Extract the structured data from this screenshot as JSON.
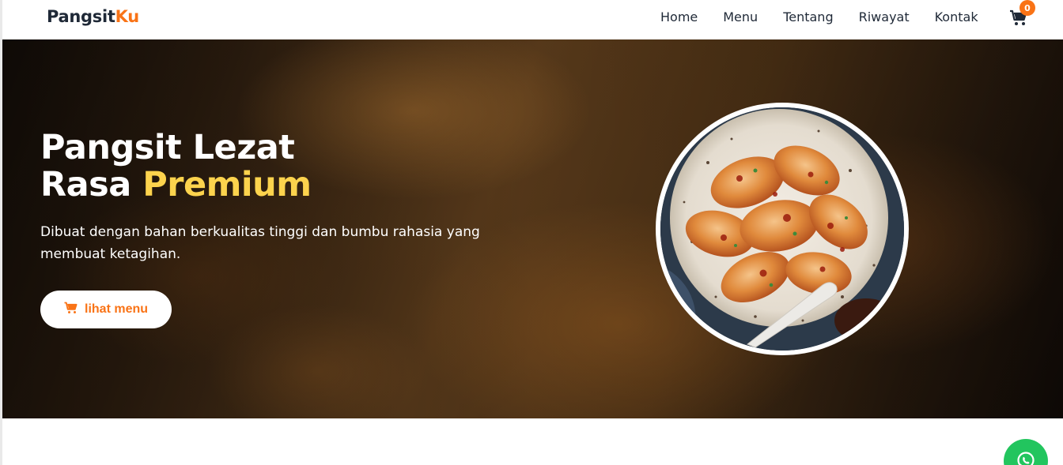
{
  "nav": {
    "logo_main": "Pangsit",
    "logo_accent": "Ku",
    "links": [
      "Home",
      "Menu",
      "Tentang",
      "Riwayat",
      "Kontak"
    ],
    "cart_count": "0"
  },
  "hero": {
    "title_line1": "Pangsit Lezat",
    "title_line2_prefix": "Rasa ",
    "title_line2_highlight": "Premium",
    "subtitle": "Dibuat dengan bahan berkualitas tinggi dan bumbu rahasia yang membuat ketagihan.",
    "button_label": "lihat menu"
  },
  "icons": {
    "cart": "cart-icon",
    "button": "cart-icon",
    "fab": "whatsapp-icon"
  },
  "colors": {
    "accent": "#f97316",
    "highlight": "#fcd34d",
    "whatsapp": "#22c55e",
    "text_dark": "#1f2937"
  }
}
